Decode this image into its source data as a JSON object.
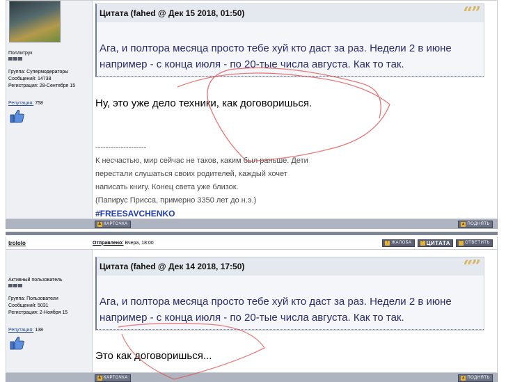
{
  "post1": {
    "user": {
      "rank": "Поллитрук",
      "group": "Группа: Супермодераторы",
      "messages": "Сообщений: 14738",
      "registered": "Регистрация: 28-Сентября 15",
      "reputation_label": "Репутация:",
      "reputation_value": "758"
    },
    "quote": {
      "title": "Цитата (fahed @ Дек 15 2018, 01:50)",
      "marks": "“”",
      "text": "Ага, и полтора месяца просто тебе хуй кто даст за раз. Недели 2 в июне например - с конца июля - по 20-тые числа августа. Как то так."
    },
    "reply": "Ну, это уже дело техники, как договоришься.",
    "signature": {
      "rule": "--------------------",
      "lines": [
        "К несчастью, мир сейчас не таков, каким был раньше. Дети",
        "перестали слушаться своих родителей, каждый хочет",
        "написать книгу. Конец света уже близок.",
        "(Папирус Присса, примерно 3350 лет до н.э.)"
      ],
      "hashtag": "#FREESAVCHENKO"
    },
    "footer": {
      "card": "КАРТОЧКА",
      "up": "ПОДНЯТЬ"
    }
  },
  "post2": {
    "header": {
      "username": "trololo",
      "posted_label": "Отправлено:",
      "posted_value": "Вчера, 18:00",
      "complaint": "ЖАЛОБА",
      "quote": "ЦИТАТА",
      "answer": "ОТВЕТИТЬ"
    },
    "user": {
      "rank": "Активный пользователь",
      "group": "Группа: Пользователи",
      "messages": "Сообщений: 5031",
      "registered": "Регистрация: 2-Ноября 15",
      "reputation_label": "Репутация:",
      "reputation_value": "138"
    },
    "quote": {
      "title": "Цитата (fahed @ Дек 14 2018, 17:50)",
      "marks": "“”",
      "text": "Ага, и полтора месяца просто тебе хуй кто даст за раз. Недели 2 в июне например - с конца июля - по 20-тые числа августа. Как то так."
    },
    "reply": "Это как договоришься...",
    "footer": {
      "card": "КАРТОЧКА",
      "up": "ПОДНЯТЬ"
    }
  },
  "colors": {
    "scribble": "#e34a4a",
    "quote_marks": "#d6b55d",
    "hashtag": "#1d3bb8"
  }
}
